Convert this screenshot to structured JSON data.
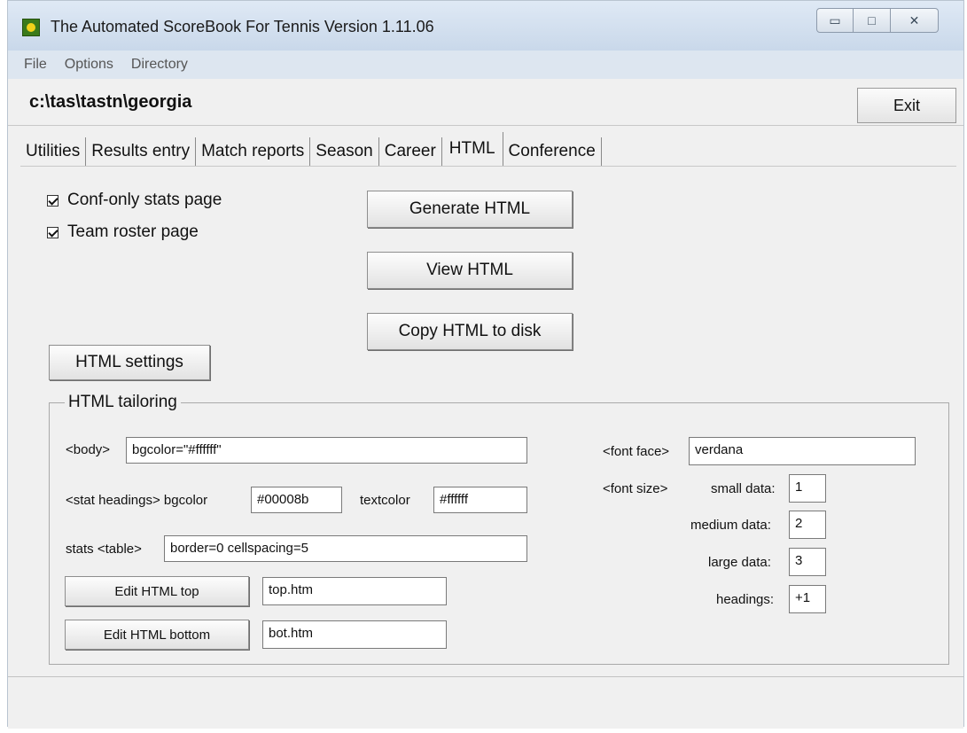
{
  "window": {
    "title": "The Automated ScoreBook For Tennis  Version 1.11.06",
    "controls": {
      "minimize": "▭",
      "maximize": "□",
      "close": "✕"
    }
  },
  "menu": [
    "File",
    "Options",
    "Directory"
  ],
  "path": "c:\\tas\\tastn\\georgia",
  "exit_label": "Exit",
  "tabs": [
    {
      "label": "Utilities"
    },
    {
      "label": "Results entry"
    },
    {
      "label": "Match reports"
    },
    {
      "label": "Season"
    },
    {
      "label": "Career"
    },
    {
      "label": "HTML"
    },
    {
      "label": "Conference"
    }
  ],
  "active_tab": "HTML",
  "options": {
    "conf_only": {
      "label": "Conf-only stats page",
      "checked": true
    },
    "team_roster": {
      "label": "Team roster page",
      "checked": true
    }
  },
  "buttons": {
    "generate": "Generate HTML",
    "view": "View HTML",
    "copy": "Copy HTML to disk",
    "settings": "HTML settings",
    "edit_top": "Edit HTML top",
    "edit_bottom": "Edit HTML bottom"
  },
  "tailoring": {
    "legend": "HTML tailoring",
    "body_label": "<body>",
    "body_value": "bgcolor=\"#ffffff\"",
    "stat_headings_label": "<stat headings>  bgcolor",
    "stat_bgcolor": "#00008b",
    "textcolor_label": "textcolor",
    "textcolor": "#ffffff",
    "table_label": "stats <table>",
    "table_value": "border=0 cellspacing=5",
    "top_file": "top.htm",
    "bottom_file": "bot.htm",
    "font_face_label": "<font face>",
    "font_face": "verdana",
    "font_size_label": "<font size>",
    "small_label": "small data:",
    "small": "1",
    "medium_label": "medium data:",
    "medium": "2",
    "large_label": "large data:",
    "large": "3",
    "headings_label": "headings:",
    "headings": "+1"
  }
}
